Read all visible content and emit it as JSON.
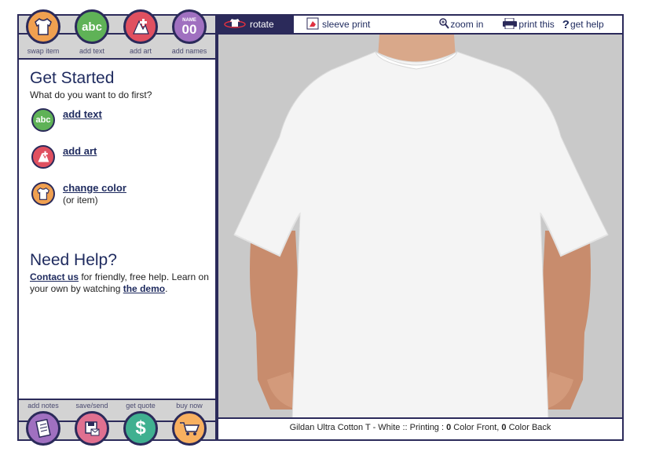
{
  "top_tools": [
    {
      "label": "swap item",
      "icon": "tshirt-icon",
      "color": "#f0a050"
    },
    {
      "label": "add text",
      "icon": "abc-icon",
      "color": "#5fb257",
      "icon_text": "abc"
    },
    {
      "label": "add art",
      "icon": "add-art-icon",
      "color": "#e05060"
    },
    {
      "label": "add names",
      "icon": "name-number-icon",
      "color": "#a070c0",
      "icon_text_top": "NAME",
      "icon_text_bottom": "00"
    }
  ],
  "bottom_tools": [
    {
      "label": "add notes",
      "icon": "notepad-icon",
      "color": "#a070c0"
    },
    {
      "label": "save/send",
      "icon": "save-icon",
      "color": "#e07090"
    },
    {
      "label": "get quote",
      "icon": "dollar-icon",
      "color": "#40b090",
      "icon_text": "$"
    },
    {
      "label": "buy now",
      "icon": "cart-icon",
      "color": "#f8b060"
    }
  ],
  "get_started": {
    "title": "Get Started",
    "subtitle": "What do you want to do first?",
    "actions": [
      {
        "label": "add text",
        "icon_text": "abc"
      },
      {
        "label": "add art"
      },
      {
        "label": "change color",
        "note": "(or item)"
      }
    ]
  },
  "need_help": {
    "title": "Need Help?",
    "contact_link": "Contact us",
    "text1": " for friendly, free help. Learn on your own by watching ",
    "demo_link": "the demo",
    "text2": "."
  },
  "toolbar": {
    "rotate": "rotate",
    "sleeve": "sleeve print",
    "zoom": "zoom in",
    "print": "print this",
    "help": "get help",
    "help_prefix": "?"
  },
  "status": {
    "prefix": "Gildan Ultra Cotton T - White :: Printing : ",
    "front_count": "0",
    "front_label": " Color Front, ",
    "back_count": "0",
    "back_label": " Color Back"
  }
}
